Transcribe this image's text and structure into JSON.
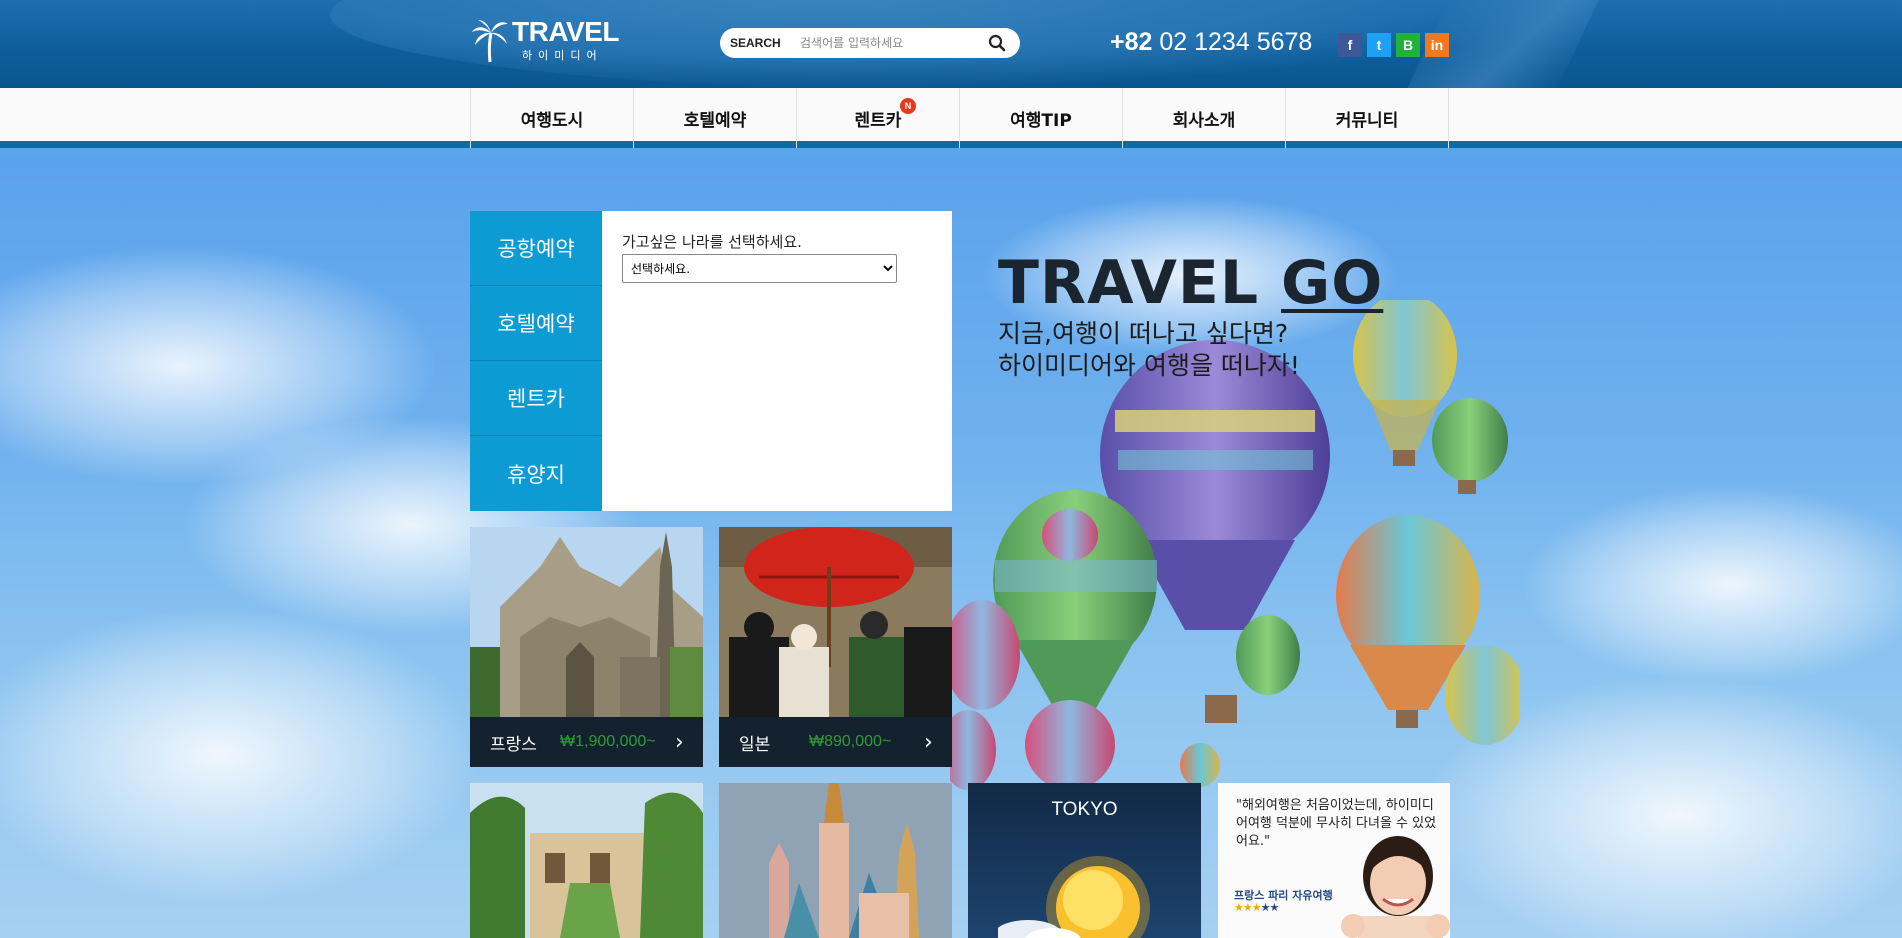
{
  "header": {
    "logo_main": "TRAVEL",
    "logo_sub": "하이미디어",
    "search": {
      "label": "SEARCH",
      "placeholder": "검색어를 입력하세요"
    },
    "phone_prefix": "+82",
    "phone_number": "02 1234 5678",
    "social": [
      {
        "icon": "facebook-icon",
        "glyph": "f",
        "color": "#3b5998"
      },
      {
        "icon": "twitter-icon",
        "glyph": "t",
        "color": "#1da1f2"
      },
      {
        "icon": "blog-icon",
        "glyph": "B",
        "color": "#21b23a"
      },
      {
        "icon": "linkedin-icon",
        "glyph": "in",
        "color": "#f0781e"
      }
    ]
  },
  "nav": {
    "items": [
      "여행도시",
      "호텔예약",
      "렌트카",
      "여행TIP",
      "회사소개",
      "커뮤니티"
    ],
    "new_badge": "N"
  },
  "booking": {
    "tabs": [
      "공항예약",
      "호텔예약",
      "렌트카",
      "휴양지"
    ],
    "label": "가고싶은 나라를 선택하세요.",
    "select_value": "선택하세요."
  },
  "hero": {
    "title_word": "TRAVEL",
    "title_underlined": "GO",
    "subtitle_line1": "지금,여행이 떠나고 싶다면?",
    "subtitle_line2": "하이미디어와 여행을 떠나자!"
  },
  "destinations": [
    {
      "name": "프랑스",
      "price": "₩1,900,000~"
    },
    {
      "name": "일본",
      "price": "₩890,000~"
    }
  ],
  "weather": {
    "city": "TOKYO"
  },
  "review": {
    "quote": "\"해외여행은 처음이었는데, 하이미디어여행 덕분에 무사히 다녀올 수 있었어요.\"",
    "trip": "프랑스 파리 자유여행",
    "rating": 3,
    "rating_max": 5
  },
  "colors": {
    "accent": "#0c9bd3",
    "header": "#0f5e9c",
    "price": "#2e9a3a",
    "badge": "#e53a1e"
  }
}
